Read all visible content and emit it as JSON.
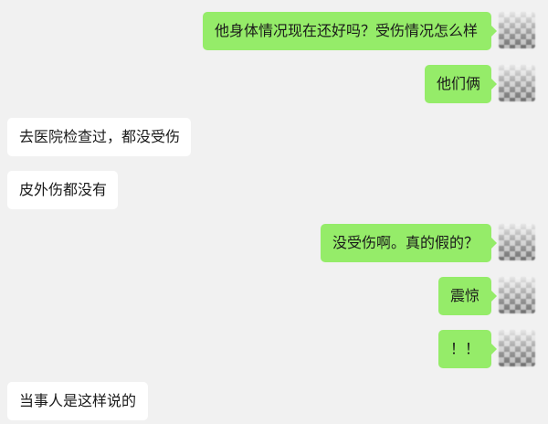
{
  "messages": [
    {
      "side": "right",
      "text": "他身体情况现在还好吗？受伤情况怎么样"
    },
    {
      "side": "right",
      "text": "他们俩"
    },
    {
      "side": "left",
      "text": "去医院检查过，都没受伤"
    },
    {
      "side": "left",
      "text": "皮外伤都没有"
    },
    {
      "side": "right",
      "text": "没受伤啊。真的假的？"
    },
    {
      "side": "right",
      "text": "震惊"
    },
    {
      "side": "right",
      "text": "！！"
    },
    {
      "side": "left",
      "text": "当事人是这样说的"
    }
  ],
  "colors": {
    "background": "#f1f1f1",
    "outgoing_bubble": "#95ec69",
    "incoming_bubble": "#ffffff"
  },
  "avatar_icon": "blurred-avatar"
}
